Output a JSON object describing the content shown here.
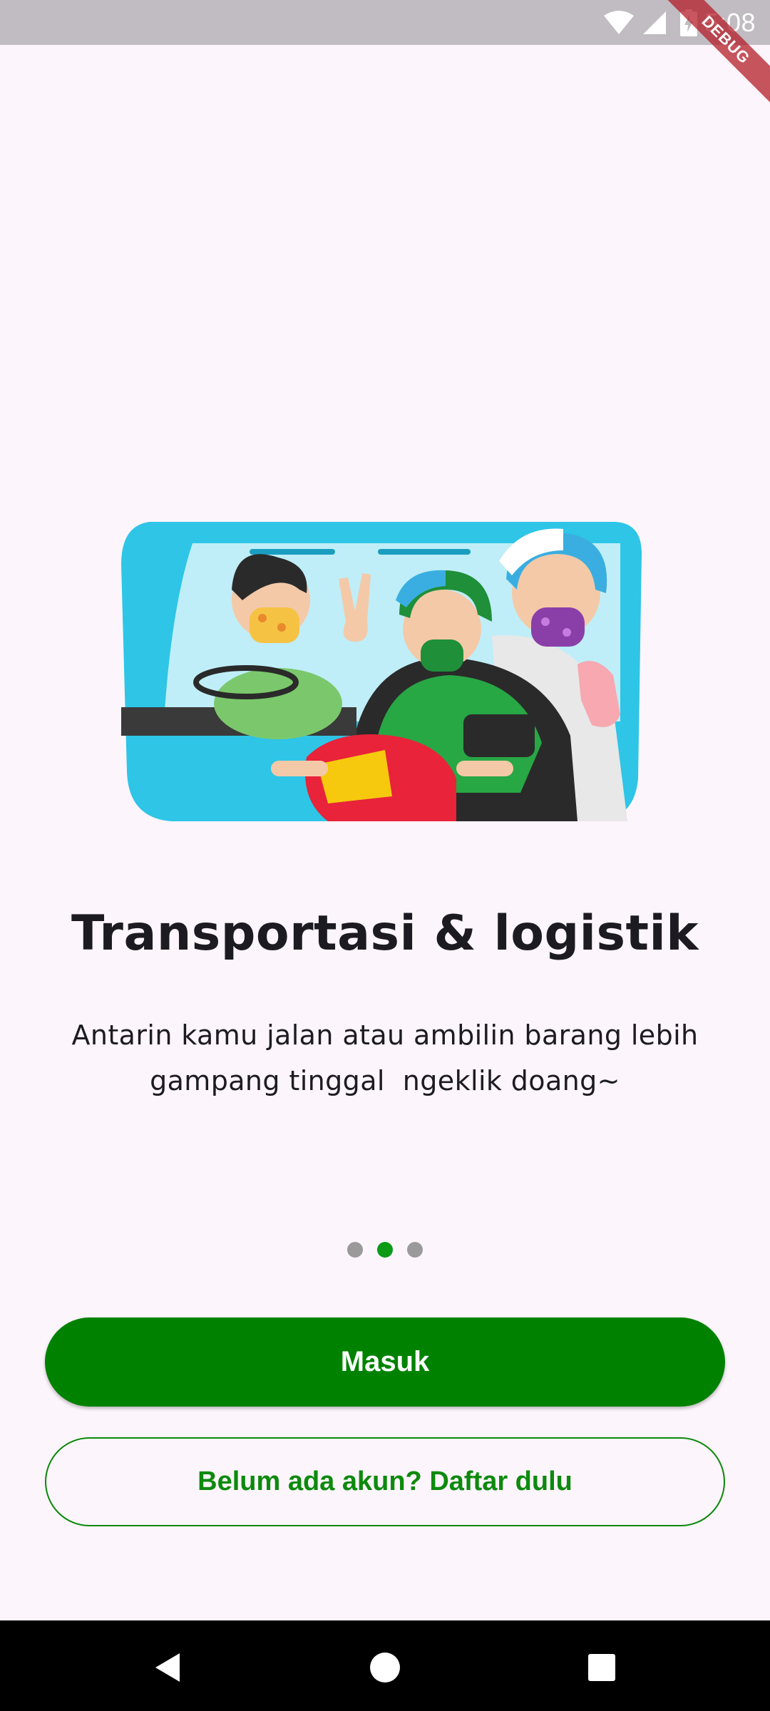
{
  "status_bar": {
    "time": "5:08",
    "icons": [
      "wifi-icon",
      "cellular-signal-icon",
      "battery-charging-icon"
    ]
  },
  "debug_banner": {
    "label": "DEBUG"
  },
  "onboarding": {
    "illustration": "transport-illustration",
    "title": "Transportasi & logistik",
    "subtitle_line1": "Antarin kamu jalan atau ambilin barang lebih",
    "subtitle_line2": "gampang tinggal  ngeklik doang~",
    "page_indicator": {
      "total": 3,
      "active_index": 1
    }
  },
  "actions": {
    "login_label": "Masuk",
    "register_label": "Belum ada akun? Daftar dulu"
  },
  "nav_bar": {
    "icons": [
      "back-icon",
      "home-icon",
      "recents-icon"
    ]
  },
  "colors": {
    "primary": "#008200",
    "background": "#fcf5fb",
    "dot_active": "#0d9a17",
    "dot_inactive": "#9a9a9a"
  }
}
